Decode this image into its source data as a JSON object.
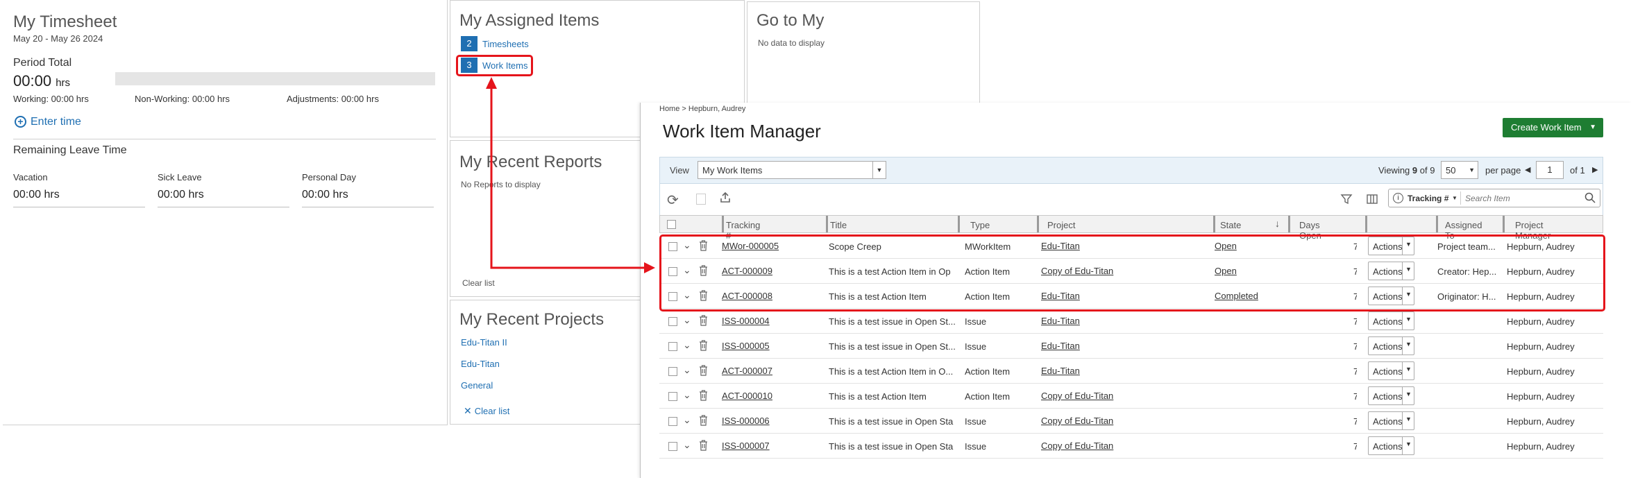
{
  "timesheet": {
    "title": "My Timesheet",
    "range": "May 20 - May 26 2024",
    "period_label": "Period Total",
    "hours": "00:00",
    "hours_unit": "hrs",
    "working": "Working: 00:00 hrs",
    "non_working": "Non-Working: 00:00 hrs",
    "adjustments": "Adjustments: 00:00 hrs",
    "enter_time": "Enter time",
    "leave_title": "Remaining Leave Time",
    "leave": [
      {
        "label": "Vacation",
        "value": "00:00 hrs"
      },
      {
        "label": "Sick Leave",
        "value": "00:00 hrs"
      },
      {
        "label": "Personal Day",
        "value": "00:00 hrs"
      }
    ]
  },
  "assigned": {
    "title": "My Assigned Items",
    "items": [
      {
        "count": "2",
        "label": "Timesheets"
      },
      {
        "count": "3",
        "label": "Work Items"
      }
    ]
  },
  "goto": {
    "title": "Go to My",
    "empty": "No data to display"
  },
  "reports": {
    "title": "My Recent Reports",
    "empty": "No Reports to display",
    "clear": "Clear list"
  },
  "projects": {
    "title": "My Recent Projects",
    "items": [
      "Edu-Titan II",
      "Edu-Titan",
      "General"
    ],
    "clear": "Clear list"
  },
  "wim": {
    "breadcrumb": "Home > Hepburn, Audrey",
    "title": "Work Item Manager",
    "create_button": "Create Work Item",
    "view_label": "View",
    "view_value": "My Work Items",
    "viewing_prefix": "Viewing",
    "viewing_count": "9",
    "viewing_of": "of 9",
    "per_page_value": "50",
    "per_page_label": "per page",
    "page_value": "1",
    "page_of": "of 1",
    "tracking_filter": "Tracking #",
    "search_placeholder": "Search Item",
    "columns": [
      "Tracking #",
      "Title",
      "Type",
      "Project",
      "State",
      "Days Open",
      "",
      "Assigned To",
      "Project Manager"
    ],
    "action_label": "Actions",
    "rows": [
      {
        "tracking": "MWor-000005",
        "title": "Scope Creep",
        "type": "MWorkItem",
        "project": "Edu-Titan",
        "state": "Open",
        "days": "7",
        "assigned": "Project team...",
        "pm": "Hepburn, Audrey"
      },
      {
        "tracking": "ACT-000009",
        "title": "This is a test Action Item in Op",
        "type": "Action Item",
        "project": "Copy of Edu-Titan",
        "state": "Open",
        "days": "7",
        "assigned": "Creator: Hep...",
        "pm": "Hepburn, Audrey"
      },
      {
        "tracking": "ACT-000008",
        "title": "This is a test Action Item",
        "type": "Action Item",
        "project": "Edu-Titan",
        "state": "Completed",
        "days": "7",
        "assigned": "Originator: H...",
        "pm": "Hepburn, Audrey"
      },
      {
        "tracking": "ISS-000004",
        "title": "This is a test issue in Open St...",
        "type": "Issue",
        "project": "Edu-Titan",
        "state": "",
        "days": "7",
        "assigned": "",
        "pm": "Hepburn, Audrey"
      },
      {
        "tracking": "ISS-000005",
        "title": "This is a test issue in Open St...",
        "type": "Issue",
        "project": "Edu-Titan",
        "state": "",
        "days": "7",
        "assigned": "",
        "pm": "Hepburn, Audrey"
      },
      {
        "tracking": "ACT-000007",
        "title": "This is a test Action Item in O...",
        "type": "Action Item",
        "project": "Edu-Titan",
        "state": "",
        "days": "7",
        "assigned": "",
        "pm": "Hepburn, Audrey"
      },
      {
        "tracking": "ACT-000010",
        "title": "This is a test Action Item",
        "type": "Action Item",
        "project": "Copy of Edu-Titan",
        "state": "",
        "days": "7",
        "assigned": "",
        "pm": "Hepburn, Audrey"
      },
      {
        "tracking": "ISS-000006",
        "title": "This is a test issue in Open Sta",
        "type": "Issue",
        "project": "Copy of Edu-Titan",
        "state": "",
        "days": "7",
        "assigned": "",
        "pm": "Hepburn, Audrey"
      },
      {
        "tracking": "ISS-000007",
        "title": "This is a test issue in Open Sta",
        "type": "Issue",
        "project": "Copy of Edu-Titan",
        "state": "",
        "days": "7",
        "assigned": "",
        "pm": "Hepburn, Audrey"
      }
    ]
  },
  "colors": {
    "link": "#1f6fb2",
    "accent_green": "#1e7d32",
    "highlight_red": "#e5141b"
  }
}
